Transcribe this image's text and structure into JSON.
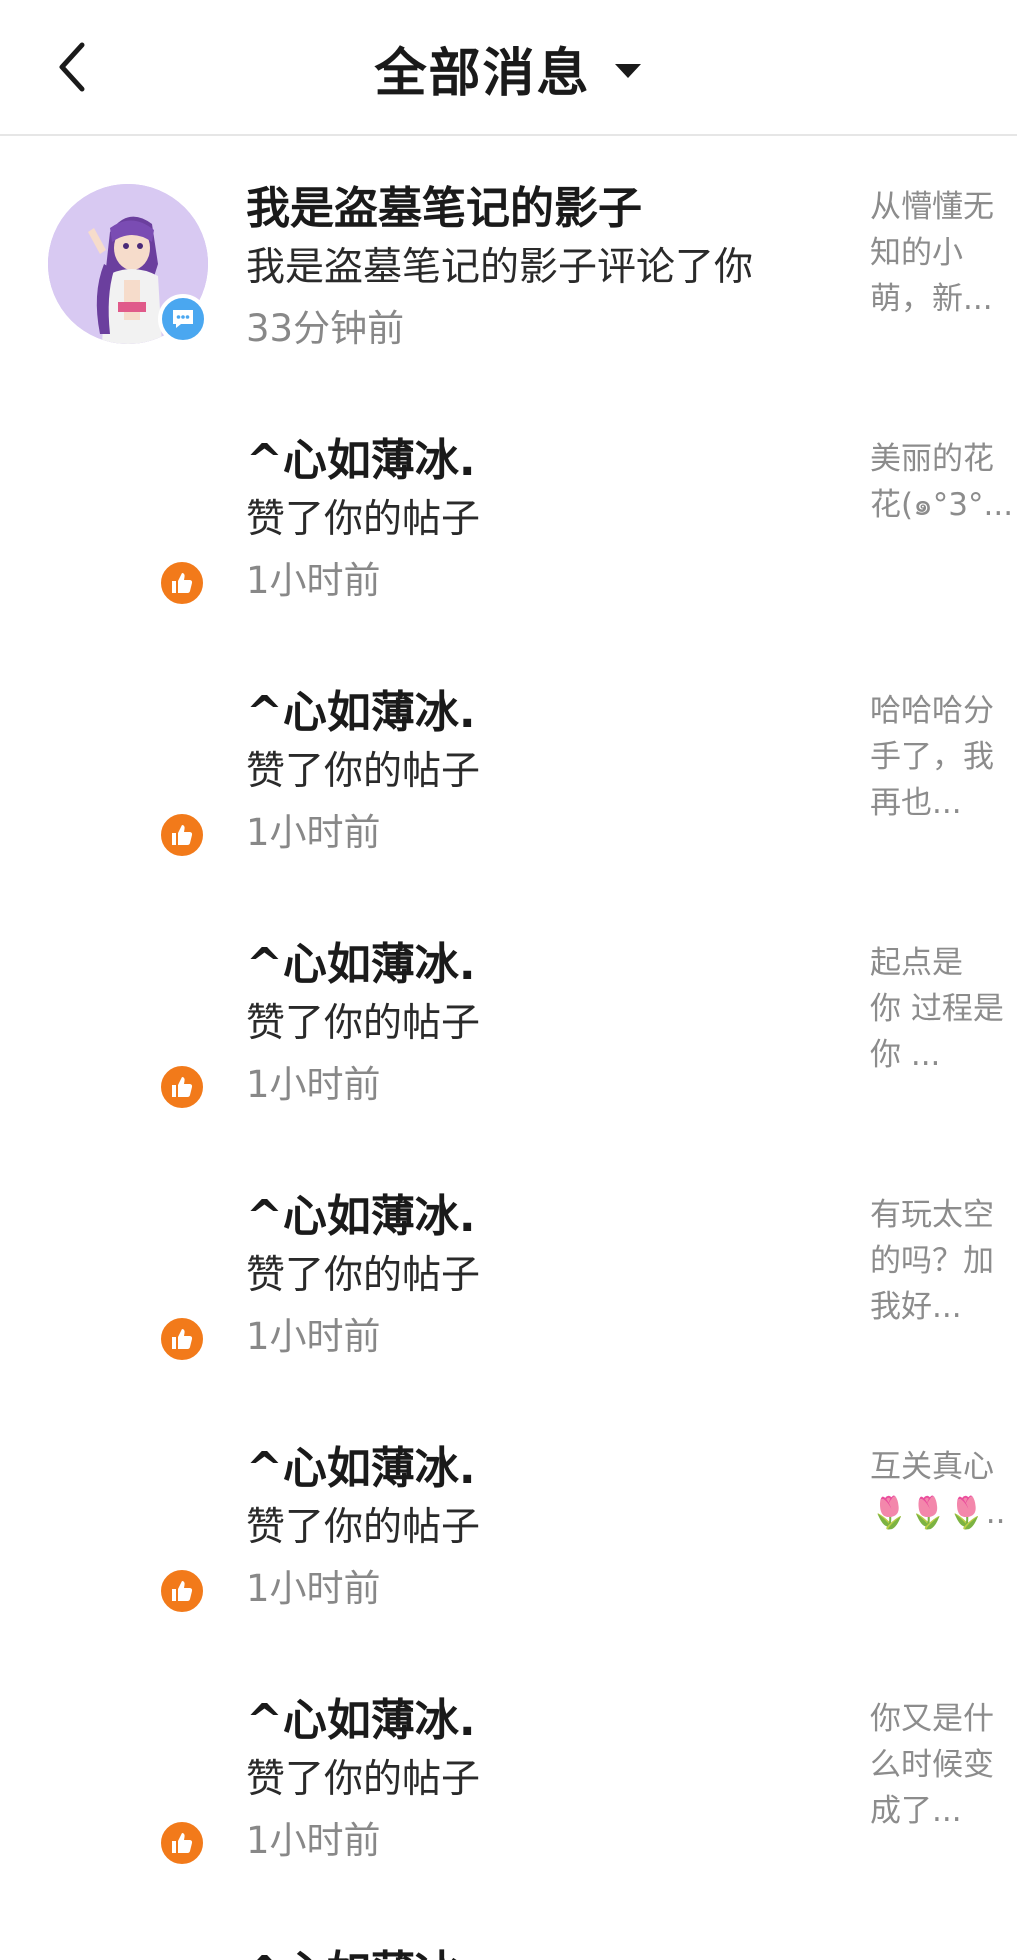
{
  "header": {
    "title": "全部消息"
  },
  "messages": [
    {
      "name": "我是盗墓笔记的影子",
      "action": "我是盗墓笔记的影子评论了你",
      "time": "33分钟前",
      "type": "comment",
      "badge_icon": "comment-icon",
      "preview": [
        "从懵懂无",
        "知的小",
        "萌，新..."
      ]
    },
    {
      "name": "^心如薄冰.",
      "action": "赞了你的帖子",
      "time": "1小时前",
      "type": "like",
      "badge_icon": "thumbs-up-icon",
      "preview": [
        "美丽的花",
        "花(๑°3°..."
      ]
    },
    {
      "name": "^心如薄冰.",
      "action": "赞了你的帖子",
      "time": "1小时前",
      "type": "like",
      "badge_icon": "thumbs-up-icon",
      "preview": [
        "哈哈哈分",
        "手了，我",
        "再也..."
      ]
    },
    {
      "name": "^心如薄冰.",
      "action": "赞了你的帖子",
      "time": "1小时前",
      "type": "like",
      "badge_icon": "thumbs-up-icon",
      "preview": [
        "起点是",
        "你 过程是",
        "你 ..."
      ]
    },
    {
      "name": "^心如薄冰.",
      "action": "赞了你的帖子",
      "time": "1小时前",
      "type": "like",
      "badge_icon": "thumbs-up-icon",
      "preview": [
        "有玩太空",
        "的吗？加",
        "我好..."
      ]
    },
    {
      "name": "^心如薄冰.",
      "action": "赞了你的帖子",
      "time": "1小时前",
      "type": "like",
      "badge_icon": "thumbs-up-icon",
      "preview": [
        "互关真心",
        "🌷🌷🌷.."
      ]
    },
    {
      "name": "^心如薄冰.",
      "action": "赞了你的帖子",
      "time": "1小时前",
      "type": "like",
      "badge_icon": "thumbs-up-icon",
      "preview": [
        "你又是什",
        "么时候变",
        "成了..."
      ]
    },
    {
      "name": "^心如薄冰.",
      "action": "",
      "time": "",
      "type": "like",
      "badge_icon": "thumbs-up-icon",
      "preview": []
    }
  ],
  "colors": {
    "like_badge": "#f27a1a",
    "comment_badge": "#4aa7f0",
    "secondary_text": "#888888",
    "preview_text": "#8c8c8c"
  }
}
